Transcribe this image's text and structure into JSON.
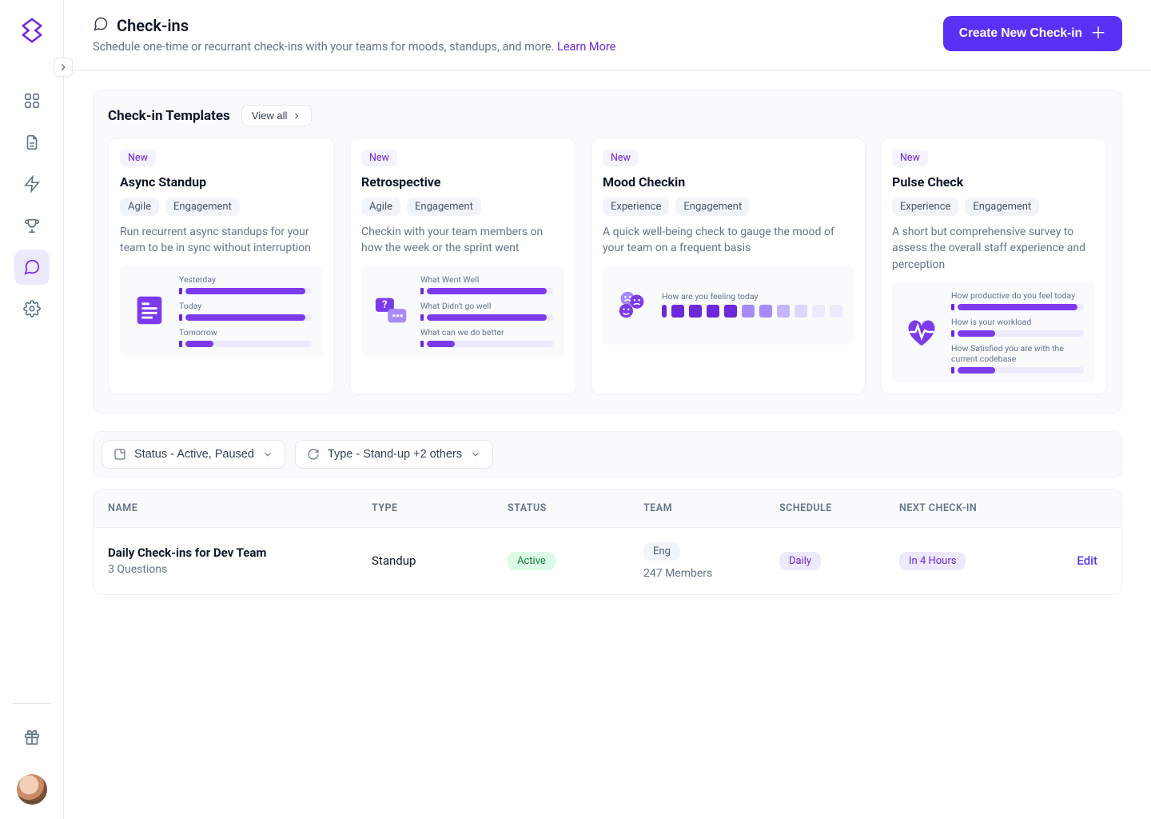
{
  "header": {
    "title": "Check-ins",
    "subtitle_pre": "Schedule one-time or recurrant check-ins with your teams for moods, standups, and more. ",
    "learn_more": "Learn More",
    "create_button": "Create New Check-in"
  },
  "templates": {
    "title": "Check-in Templates",
    "view_all": "View all",
    "new_badge": "New",
    "cards": [
      {
        "name": "Async Standup",
        "tags": [
          "Agile",
          "Engagement"
        ],
        "desc": "Run recurrent async standups for your team to be in sync without interruption",
        "preview_labels": [
          "Yesterday",
          "Today",
          "Tomorrow"
        ],
        "preview_fills": [
          95,
          95,
          22
        ]
      },
      {
        "name": "Retrospective",
        "tags": [
          "Agile",
          "Engagement"
        ],
        "desc": "Checkin with your team members on how the week or the sprint went",
        "preview_labels": [
          "What Went Well",
          "What Didn't go well",
          "What can we do better"
        ],
        "preview_fills": [
          95,
          95,
          22
        ]
      },
      {
        "name": "Mood Checkin",
        "tags": [
          "Experience",
          "Engagement"
        ],
        "desc": "A quick well-being check to gauge the mood of your team on a frequent basis",
        "preview_labels": [
          "How are you feeling today"
        ],
        "preview_fills": []
      },
      {
        "name": "Pulse Check",
        "tags": [
          "Experience",
          "Engagement"
        ],
        "desc": "A short but comprehensive survey to assess the overall staff experience and perception",
        "preview_labels": [
          "How productive do you feel today",
          "How is your workload",
          "How Satisfied you are with the current codebase"
        ],
        "preview_fills": [
          95,
          30,
          30
        ]
      }
    ]
  },
  "filters": {
    "status": "Status - Active, Paused",
    "type": "Type - Stand-up +2 others"
  },
  "table": {
    "headers": {
      "name": "NAME",
      "type": "TYPE",
      "status": "STATUS",
      "team": "TEAM",
      "schedule": "SCHEDULE",
      "next": "NEXT CHECK-IN"
    },
    "row": {
      "name": "Daily Check-ins for Dev Team",
      "sub": "3 Questions",
      "type": "Standup",
      "status": "Active",
      "team_tag": "Eng",
      "team_members": "247 Members",
      "schedule": "Daily",
      "next": "In 4 Hours",
      "edit": "Edit"
    }
  }
}
